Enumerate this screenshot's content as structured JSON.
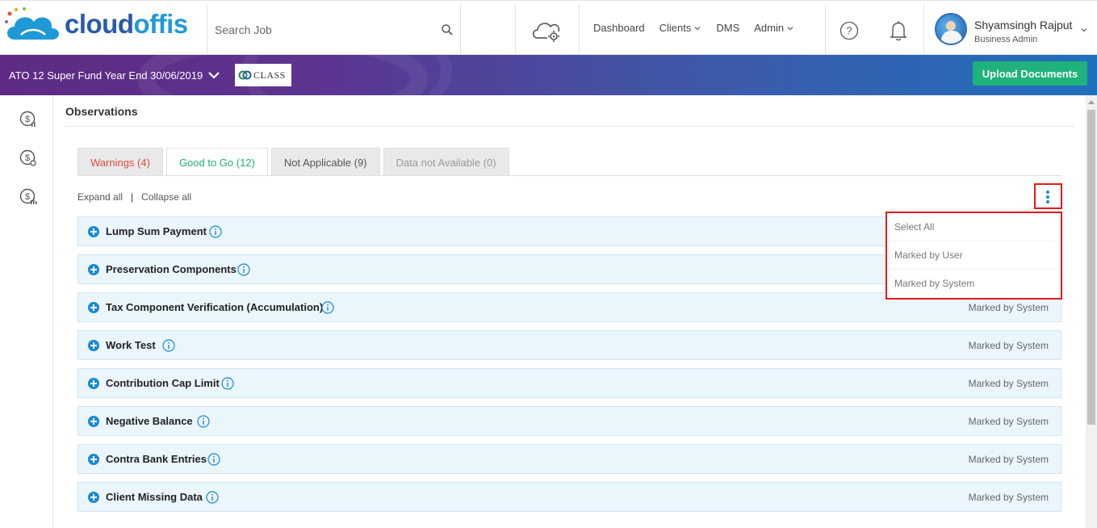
{
  "brand": {
    "name_part1": "cloud",
    "name_part2": "offis",
    "logo_icon": "cloud-logo-icon",
    "primary_color": "#2a5aa8",
    "accent_color": "#1f9ad6"
  },
  "header": {
    "search_placeholder": "Search Job",
    "nav": [
      {
        "label": "Dashboard",
        "has_dropdown": false
      },
      {
        "label": "Clients",
        "has_dropdown": true
      },
      {
        "label": "DMS",
        "has_dropdown": false
      },
      {
        "label": "Admin",
        "has_dropdown": true
      }
    ],
    "user": {
      "name": "Shyamsingh Rajput",
      "role": "Business Admin"
    }
  },
  "banner": {
    "job_title": "ATO 12 Super Fund Year End 30/06/2019",
    "integration_logo_text": "CLASS",
    "upload_button": "Upload Documents",
    "upload_color": "#1fb27a"
  },
  "main": {
    "title": "Observations",
    "tabs": [
      {
        "label": "Warnings (4)",
        "state": "warning"
      },
      {
        "label": "Good to Go (12)",
        "state": "active"
      },
      {
        "label": "Not Applicable (9)",
        "state": "default"
      },
      {
        "label": "Data not Available (0)",
        "state": "muted"
      }
    ],
    "expand_all": "Expand all",
    "separator": "|",
    "collapse_all": "Collapse all",
    "menu": {
      "items": [
        "Select All",
        "Marked by User",
        "Marked by System"
      ]
    },
    "rows": [
      {
        "label": "Lump Sum Payment",
        "status": ""
      },
      {
        "label": "Preservation Components",
        "status": ""
      },
      {
        "label": "Tax Component Verification (Accumulation)",
        "status": "Marked by System"
      },
      {
        "label": "Work Test",
        "status": "Marked by System"
      },
      {
        "label": "Contribution Cap Limit",
        "status": "Marked by System"
      },
      {
        "label": "Negative Balance",
        "status": "Marked by System"
      },
      {
        "label": "Contra Bank Entries",
        "status": "Marked by System"
      },
      {
        "label": "Client Missing Data",
        "status": "Marked by System"
      }
    ]
  }
}
